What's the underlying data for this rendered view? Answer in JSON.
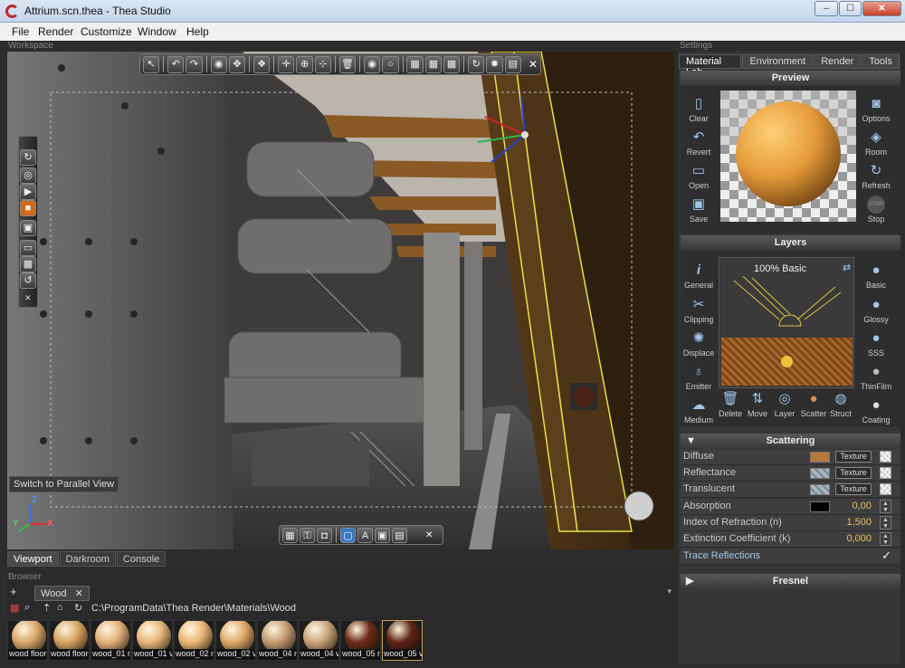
{
  "window": {
    "title": "Attrium.scn.thea - Thea Studio",
    "min_glyph": "–",
    "max_glyph": "☐",
    "close_glyph": "✕"
  },
  "menu": [
    "File",
    "Render",
    "Customize",
    "Window",
    "Help"
  ],
  "workspace": {
    "caption": "Workspace"
  },
  "viewport": {
    "toolbar_close": "✕",
    "hint": "Switch to Parallel View",
    "axes": {
      "z": "Z",
      "x": "X",
      "y": "Y"
    },
    "tabs": [
      "Viewport",
      "Darkroom",
      "Console"
    ]
  },
  "browser": {
    "caption": "Browser",
    "tab_label": "Wood",
    "tab_close": "✕",
    "plus": "+",
    "path": "C:\\ProgramData\\Thea Render\\Materials\\Wood",
    "thumbnails": [
      {
        "label": "wood floor",
        "color": "#d9a86c"
      },
      {
        "label": "wood floor",
        "color": "#d7a462"
      },
      {
        "label": "wood_01 n",
        "color": "#e2b27a"
      },
      {
        "label": "wood_01 v",
        "color": "#e7b87c"
      },
      {
        "label": "wood_02 n",
        "color": "#eab777"
      },
      {
        "label": "wood_02 v",
        "color": "#dfa96a"
      },
      {
        "label": "wood_04 n",
        "color": "#c49d73"
      },
      {
        "label": "wood_04 v",
        "color": "#c9a57c"
      },
      {
        "label": "wood_05 n",
        "color": "#6a2b18"
      },
      {
        "label": "wood_05 v",
        "color": "#5c2415"
      }
    ]
  },
  "settings": {
    "caption": "Settings",
    "tabs": [
      "Material Lab",
      "Environment",
      "Render",
      "Tools"
    ],
    "preview": {
      "header": "Preview",
      "left_buttons": [
        "Clear",
        "Revert",
        "Open",
        "Save"
      ],
      "right_buttons": [
        "Options",
        "Room",
        "Refresh",
        "Stop"
      ],
      "stop_text": "STOP"
    },
    "layers": {
      "header": "Layers",
      "left_buttons": [
        "General",
        "Clipping",
        "Displace",
        "Emitter",
        "Medium"
      ],
      "right_buttons": [
        "Basic",
        "Glossy",
        "SSS",
        "ThinFilm",
        "Coating"
      ],
      "layer_title": "100% Basic",
      "bottom_buttons": [
        "Delete",
        "Move",
        "Layer",
        "Scatter",
        "Struct"
      ]
    },
    "scattering": {
      "header": "Scattering",
      "diffuse": "Diffuse",
      "reflectance": "Reflectance",
      "translucent": "Translucent",
      "texture": "Texture",
      "absorption": "Absorption",
      "absorption_value": "0,00",
      "ior": "Index of Refraction (n)",
      "ior_value": "1,500",
      "extinction": "Extinction Coefficient (k)",
      "extinction_value": "0,000",
      "trace_reflections": "Trace Reflections",
      "diffuse_color": "#b5773a"
    },
    "fresnel": {
      "header": "Fresnel"
    }
  }
}
